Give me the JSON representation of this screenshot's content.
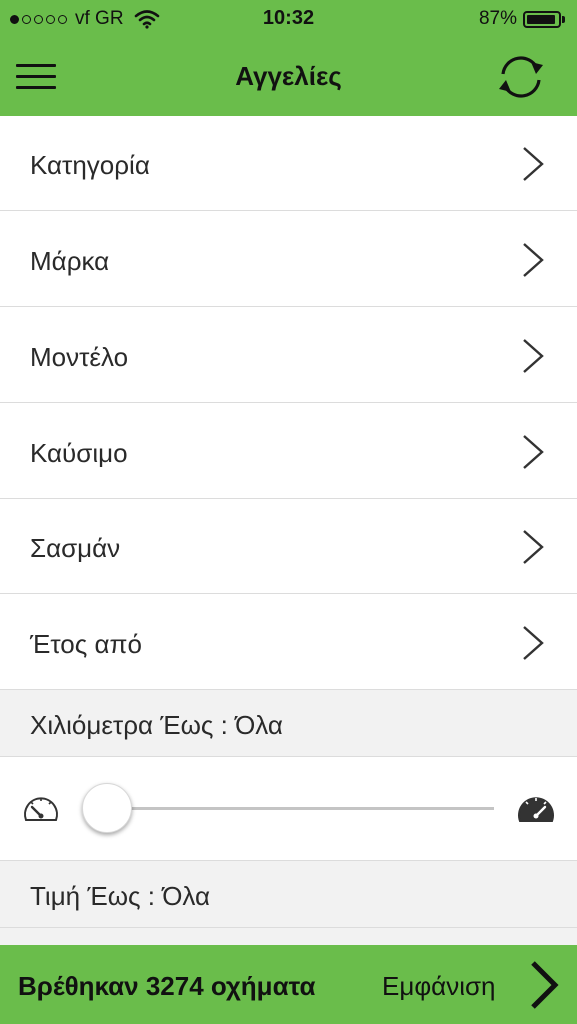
{
  "status_bar": {
    "carrier": "vf GR",
    "time": "10:32",
    "battery": "87%",
    "battery_level": 0.87,
    "signal_dots_filled": 1,
    "signal_dots_total": 5
  },
  "nav": {
    "title": "Αγγελίες",
    "menu_icon": "hamburger-menu-icon",
    "refresh_icon": "refresh-icon"
  },
  "filters": [
    {
      "label": "Κατηγορία"
    },
    {
      "label": "Μάρκα"
    },
    {
      "label": "Μοντέλο"
    },
    {
      "label": "Καύσιμο"
    },
    {
      "label": "Σασμάν"
    },
    {
      "label": "Έτος από"
    }
  ],
  "mileage": {
    "label": "Χιλιόμετρα Έως : Όλα",
    "slider_value": 0,
    "min_icon": "speedometer-low-icon",
    "max_icon": "speedometer-high-icon"
  },
  "price": {
    "label": "Τιμή Έως : Όλα"
  },
  "footer": {
    "found_text": "Βρέθηκαν 3274 οχήματα",
    "show_label": "Εμφάνιση"
  },
  "colors": {
    "accent": "#6abd4b",
    "section_bg": "#f2f2f2"
  }
}
